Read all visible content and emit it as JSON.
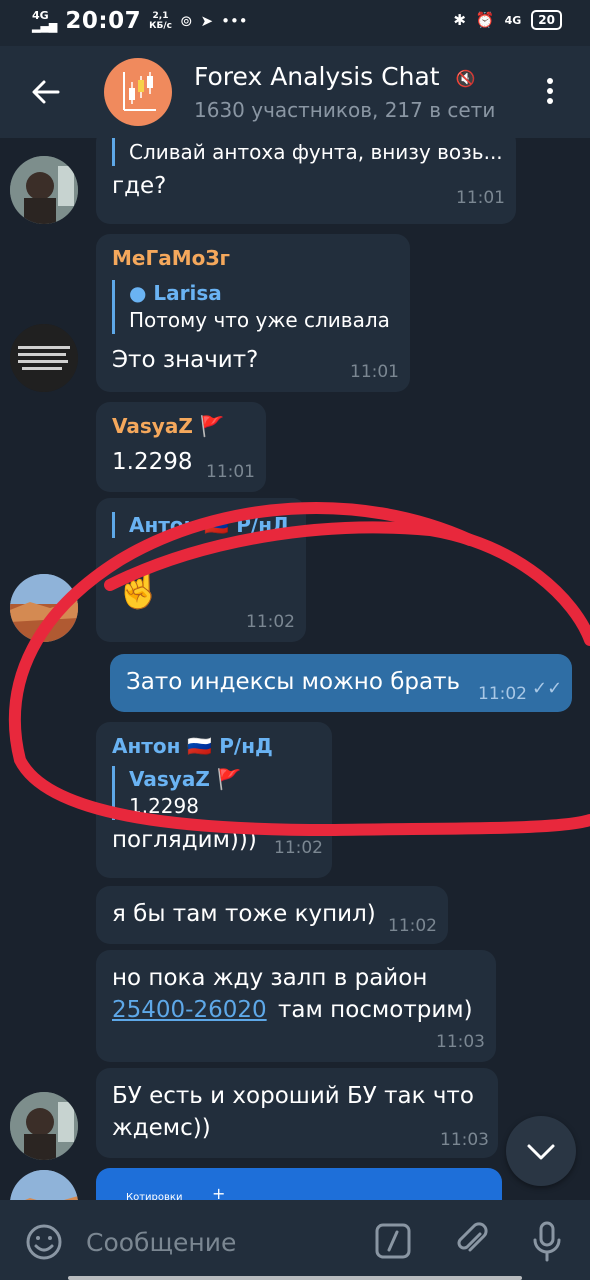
{
  "status_bar": {
    "network": "4G",
    "time": "20:07",
    "speed_value": "2,1",
    "speed_unit": "КБ/с",
    "network2": "4G",
    "battery": "20"
  },
  "header": {
    "title": "Forex Analysis Chat",
    "subtitle": "1630 участников, 217 в сети"
  },
  "messages": [
    {
      "quote_text": "Сливай антоха фунта, внизу возь...",
      "text": "где?",
      "time": "11:01"
    },
    {
      "author": "МеГаМоЗг",
      "quote_name": "Larisa",
      "quote_text": "Потому что уже сливала",
      "text": "Это значит?",
      "time": "11:01"
    },
    {
      "author": "VasyaZ",
      "text": "1.2298",
      "time": "11:01"
    },
    {
      "quote_name": "Антон 🇷🇺 Р/нД",
      "text": "☝️",
      "time": "11:02"
    },
    {
      "text": "Зато индексы можно брать",
      "time": "11:02"
    },
    {
      "author": "Антон 🇷🇺 Р/нД",
      "quote_name": "VasyaZ",
      "quote_text": "1.2298",
      "text": "поглядим)))",
      "time": "11:02"
    },
    {
      "text": "я бы там тоже купил)",
      "time": "11:02"
    },
    {
      "text_line1": "но пока жду залп в район",
      "link": "25400-26020",
      "text_line2_rest": "там посмотрим)",
      "time": "11:03"
    },
    {
      "text_line1": "БУ есть и хороший БУ так что",
      "text_line2": "ждемс))",
      "time": "11:03"
    }
  ],
  "preview": {
    "caption": "Котировки"
  },
  "input": {
    "placeholder": "Сообщение"
  },
  "colors": {
    "accent": "#5ea8e8",
    "author_orange": "#f5a85c",
    "annotation": "#e8283c",
    "outgoing": "#2f6ea5"
  }
}
